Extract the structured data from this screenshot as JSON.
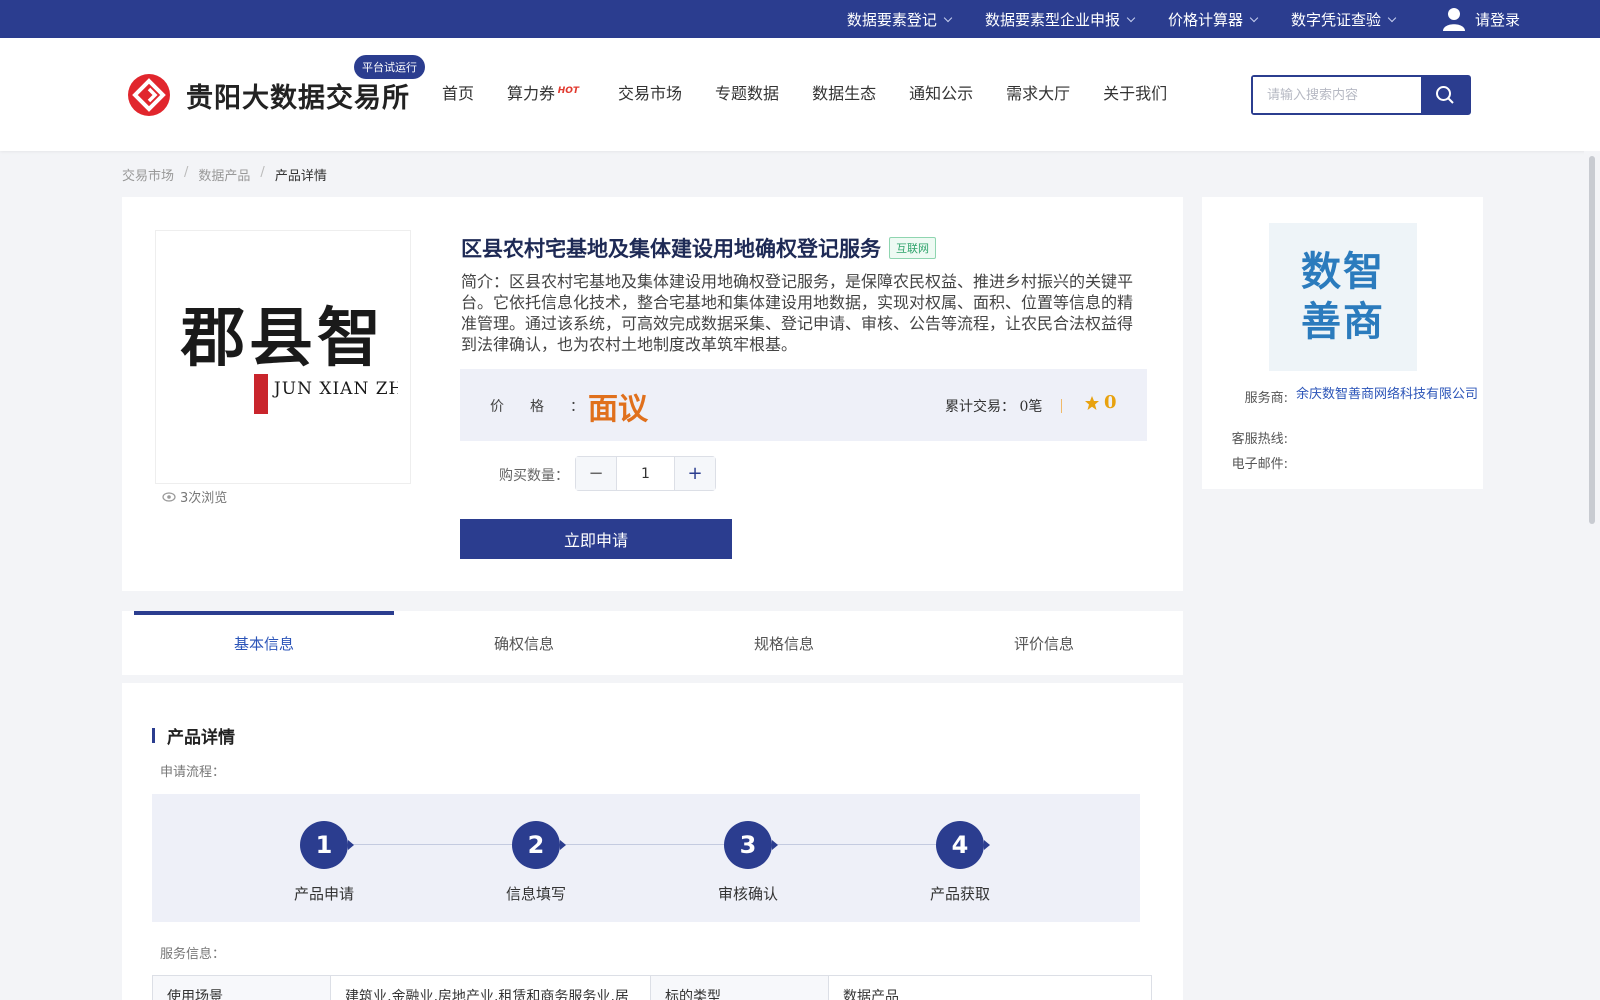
{
  "topbar": {
    "menu": [
      {
        "label": "数据要素登记"
      },
      {
        "label": "数据要素型企业申报"
      },
      {
        "label": "价格计算器"
      },
      {
        "label": "数字凭证查验"
      }
    ],
    "login_label": "请登录"
  },
  "header": {
    "brand": "贵阳大数据交易所",
    "trial_badge": "平台试运行",
    "nav": [
      {
        "label": "首页"
      },
      {
        "label": "算力券",
        "tag": "HOT"
      },
      {
        "label": "交易市场"
      },
      {
        "label": "专题数据"
      },
      {
        "label": "数据生态"
      },
      {
        "label": "通知公示"
      },
      {
        "label": "需求大厅"
      },
      {
        "label": "关于我们"
      }
    ],
    "search_placeholder": "请输入搜索内容"
  },
  "breadcrumb": [
    "交易市场",
    "数据产品",
    "产品详情"
  ],
  "product": {
    "image_text": "郡县智",
    "image_text_en": "JUN XIAN ZHI",
    "views": "3次浏览",
    "title": "区县农村宅基地及集体建设用地确权登记服务",
    "tag": "互联网",
    "description": "简介：区县农村宅基地及集体建设用地确权登记服务，是保障农民权益、推进乡村振兴的关键平台。它依托信息化技术，整合宅基地和集体建设用地数据，实现对权属、面积、位置等信息的精准管理。通过该系统，可高效完成数据采集、登记申请、审核、公告等流程，让农民合法权益得到法律确认，也为农村土地制度改革筑牢根基。",
    "price_label": "价格：",
    "price": "面议",
    "trades_label": "累计交易：",
    "trades_value": "0笔",
    "rating": "0",
    "qty_label": "购买数量：",
    "qty_value": "1",
    "apply_label": "立即申请"
  },
  "vendor": {
    "logo_line1": "数智",
    "logo_line2": "善商",
    "provider_label": "服务商:",
    "provider": "余庆数智善商网络科技有限公司",
    "hotline_label": "客服热线:",
    "email_label": "电子邮件:"
  },
  "tabs": [
    {
      "label": "基本信息"
    },
    {
      "label": "确权信息"
    },
    {
      "label": "规格信息"
    },
    {
      "label": "评价信息"
    }
  ],
  "details": {
    "title": "产品详情",
    "process_label": "申请流程：",
    "steps": [
      {
        "num": "1",
        "label": "产品申请"
      },
      {
        "num": "2",
        "label": "信息填写"
      },
      {
        "num": "3",
        "label": "审核确认"
      },
      {
        "num": "4",
        "label": "产品获取"
      }
    ],
    "service_label": "服务信息：",
    "table": {
      "k1": "使用场景",
      "v1": "建筑业,金融业,房地产业,租赁和商务服务业,居",
      "k2": "标的类型",
      "v2": "数据产品"
    }
  },
  "colors": {
    "brand": "#2b3d8f",
    "price": "#e0701c",
    "link": "#2b54b8"
  }
}
